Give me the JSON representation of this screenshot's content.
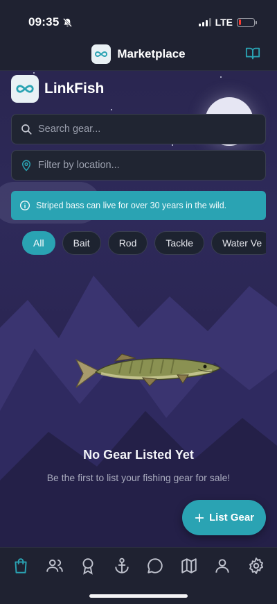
{
  "status_bar": {
    "time": "09:35",
    "network": "LTE"
  },
  "nav": {
    "title": "Marketplace"
  },
  "brand": {
    "name": "LinkFish"
  },
  "search": {
    "placeholder": "Search gear..."
  },
  "location": {
    "placeholder": "Filter by location..."
  },
  "fact": {
    "text": "Striped bass can live for over 30 years in the wild."
  },
  "filters": [
    "All",
    "Bait",
    "Rod",
    "Tackle",
    "Water Ve"
  ],
  "empty_state": {
    "title": "No Gear Listed Yet",
    "subtitle": "Be the first to list your fishing gear for sale!"
  },
  "fab": {
    "label": "List Gear"
  },
  "tabs": [
    "bag-icon",
    "users-icon",
    "award-icon",
    "anchor-icon",
    "chat-icon",
    "map-icon",
    "person-icon",
    "gear-icon"
  ],
  "colors": {
    "accent": "#2aa3b3",
    "bar": "#1f2231",
    "field": "#202532"
  }
}
